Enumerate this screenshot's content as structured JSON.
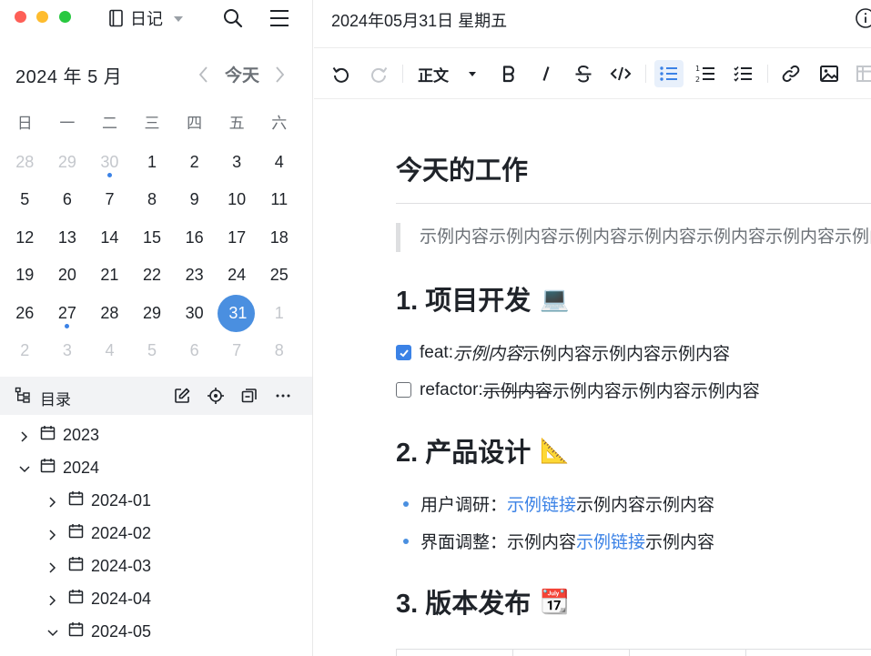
{
  "app": {
    "name": "日记"
  },
  "calendar": {
    "month_label": "2024 年 5 月",
    "today_label": "今天",
    "weekdays": [
      "日",
      "一",
      "二",
      "三",
      "四",
      "五",
      "六"
    ],
    "weeks": [
      [
        {
          "d": "28",
          "m": true
        },
        {
          "d": "29",
          "m": true
        },
        {
          "d": "30",
          "m": true,
          "dot": true
        },
        {
          "d": "1"
        },
        {
          "d": "2"
        },
        {
          "d": "3"
        },
        {
          "d": "4"
        }
      ],
      [
        {
          "d": "5"
        },
        {
          "d": "6"
        },
        {
          "d": "7"
        },
        {
          "d": "8"
        },
        {
          "d": "9"
        },
        {
          "d": "10"
        },
        {
          "d": "11"
        }
      ],
      [
        {
          "d": "12"
        },
        {
          "d": "13"
        },
        {
          "d": "14"
        },
        {
          "d": "15"
        },
        {
          "d": "16"
        },
        {
          "d": "17"
        },
        {
          "d": "18"
        }
      ],
      [
        {
          "d": "19"
        },
        {
          "d": "20"
        },
        {
          "d": "21"
        },
        {
          "d": "22"
        },
        {
          "d": "23"
        },
        {
          "d": "24"
        },
        {
          "d": "25"
        }
      ],
      [
        {
          "d": "26"
        },
        {
          "d": "27",
          "dot": true
        },
        {
          "d": "28"
        },
        {
          "d": "29"
        },
        {
          "d": "30"
        },
        {
          "d": "31",
          "sel": true,
          "dot": true
        },
        {
          "d": "1",
          "m": true
        }
      ],
      [
        {
          "d": "2",
          "m": true
        },
        {
          "d": "3",
          "m": true
        },
        {
          "d": "4",
          "m": true
        },
        {
          "d": "5",
          "m": true
        },
        {
          "d": "6",
          "m": true
        },
        {
          "d": "7",
          "m": true
        },
        {
          "d": "8",
          "m": true
        }
      ]
    ],
    "selected_color": "#4a8fe0",
    "dot_color": "#3b82e6"
  },
  "toc": {
    "title": "目录",
    "tree": [
      {
        "label": "2023",
        "level": 0,
        "expanded": false
      },
      {
        "label": "2024",
        "level": 0,
        "expanded": true
      },
      {
        "label": "2024-01",
        "level": 1,
        "expanded": false
      },
      {
        "label": "2024-02",
        "level": 1,
        "expanded": false
      },
      {
        "label": "2024-03",
        "level": 1,
        "expanded": false
      },
      {
        "label": "2024-04",
        "level": 1,
        "expanded": false
      },
      {
        "label": "2024-05",
        "level": 1,
        "expanded": true
      }
    ]
  },
  "main": {
    "date_title": "2024年05月31日 星期五",
    "toolbar": {
      "paragraph_style": "正文"
    },
    "doc": {
      "title": "今天的工作",
      "quote": "示例内容示例内容示例内容示例内容示例内容示例内容示例内容",
      "sections": [
        {
          "heading": "1. 项目开发",
          "emoji": "💻"
        },
        {
          "heading": "2. 产品设计",
          "emoji": "📐"
        },
        {
          "heading": "3. 版本发布",
          "emoji": "📆"
        }
      ],
      "tasks": [
        {
          "prefix": "feat: ",
          "italic": "示例内容",
          "rest": "示例内容示例内容示例内容",
          "checked": true
        },
        {
          "prefix": "refactor: ",
          "strike": "示例内容",
          "rest": "示例内容示例内容示例内容",
          "checked": false
        }
      ],
      "bullets": [
        {
          "label": "用户调研：",
          "link": "示例链接",
          "after": "示例内容示例内容"
        },
        {
          "label": "界面调整：",
          "before": "示例内容",
          "link": "示例链接",
          "after": "示例内容"
        }
      ]
    },
    "accent": "#3b82e6"
  }
}
